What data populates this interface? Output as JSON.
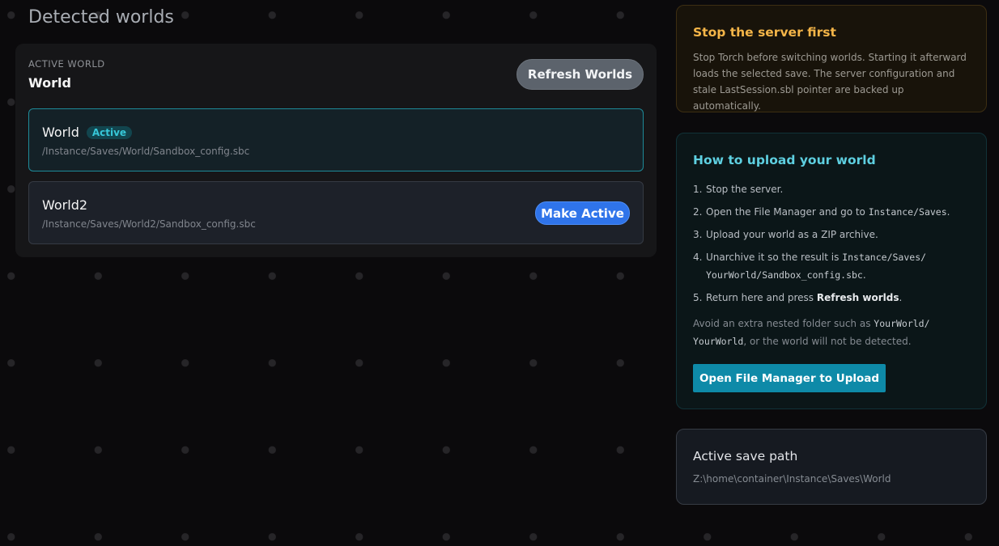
{
  "section_title": "Detected worlds",
  "worlds_panel": {
    "active_label": "ACTIVE WORLD",
    "active_name": "World",
    "refresh_label": "Refresh Worlds",
    "worlds": [
      {
        "name": "World",
        "badge": "Active",
        "path": "/Instance/Saves/World/Sandbox_config.sbc"
      },
      {
        "name": "World2",
        "path": "/Instance/Saves/World2/Sandbox_config.sbc",
        "action_label": "Make Active"
      }
    ]
  },
  "warning_card": {
    "title": "Stop the server first",
    "body": "Stop Torch before switching worlds. Starting it afterward loads the selected save. The server configuration and stale LastSession.sbl pointer are backed up automatically.",
    "accent_color": "#f4b548"
  },
  "upload_card": {
    "title": "How to upload your world",
    "steps": [
      {
        "num": "1.",
        "text": "Stop the server."
      },
      {
        "num": "2.",
        "text_before": "Open the File Manager and go to ",
        "code": "Instance/Saves",
        "text_after": "."
      },
      {
        "num": "3.",
        "text": "Upload your world as a ZIP archive."
      },
      {
        "num": "4.",
        "text_before": "Unarchive it so the result is ",
        "code": "Instance/Saves/ YourWorld/Sandbox_config.sbc",
        "text_after": "."
      },
      {
        "num": "5.",
        "text_before": "Return here and press ",
        "strong": "Refresh worlds",
        "text_after": "."
      }
    ],
    "note_before": "Avoid an extra nested folder such as ",
    "note_code": "YourWorld/ YourWorld",
    "note_after": ", or the world will not be detected.",
    "button_label": "Open File Manager to Upload",
    "accent_color": "#5ecfe0"
  },
  "path_card": {
    "title": "Active save path",
    "value": "Z:\\home\\container\\Instance\\Saves\\World"
  }
}
